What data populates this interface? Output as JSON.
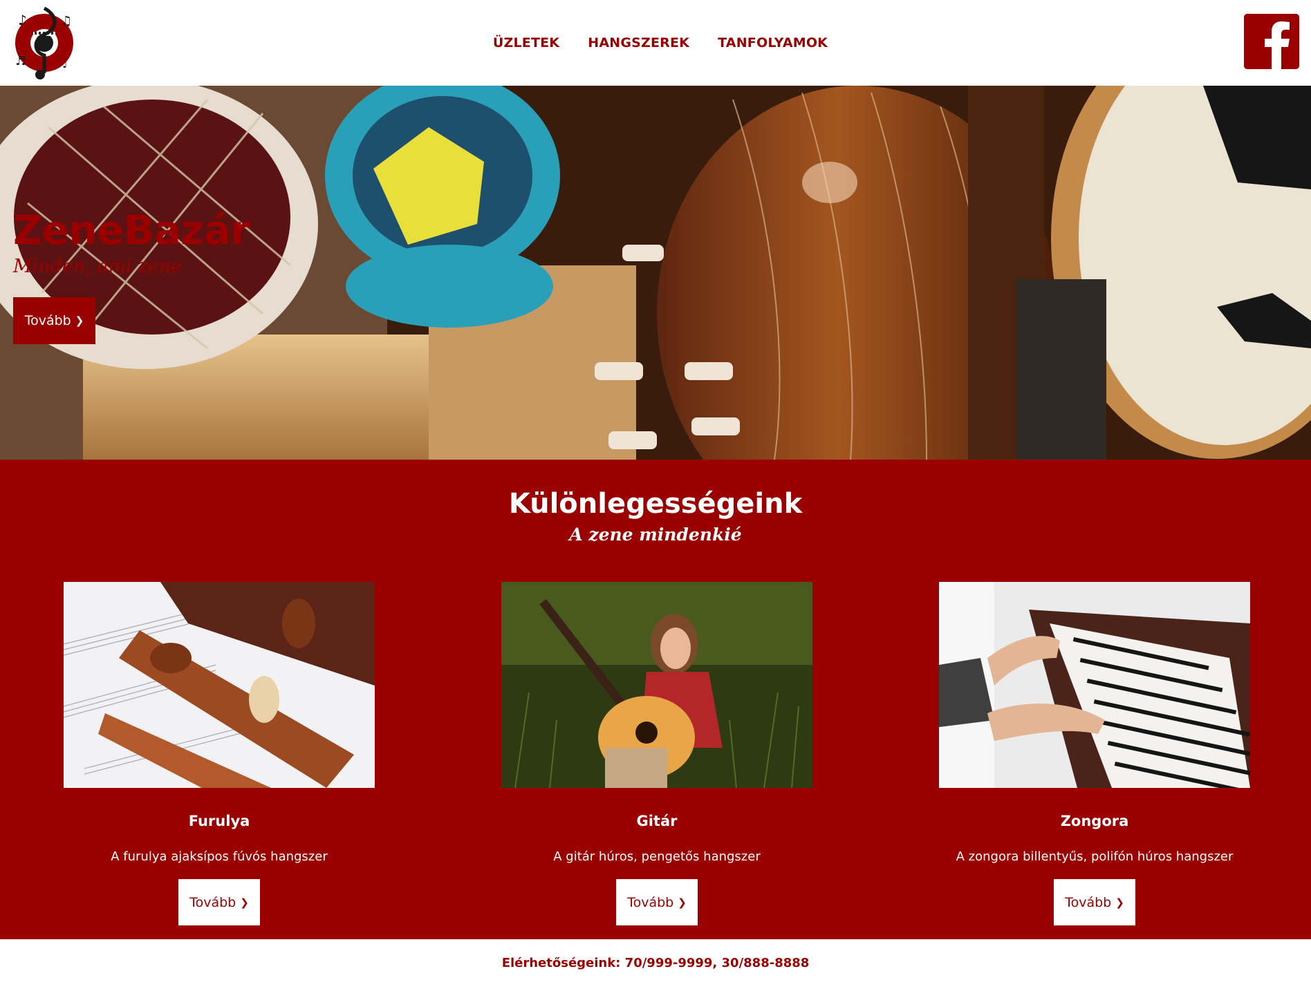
{
  "header": {
    "logo_icon": "music-note-logo-icon",
    "nav": [
      {
        "label": "ÜZLETEK"
      },
      {
        "label": "HANGSZEREK"
      },
      {
        "label": "TANFOLYAMOK"
      }
    ],
    "social_icon": "facebook-icon"
  },
  "hero": {
    "title": "ZeneBazár",
    "subtitle": "Minden, ami zene",
    "button_label": "Tovább",
    "button_icon": "chevron-right-icon"
  },
  "specials": {
    "title": "Különlegességeink",
    "subtitle": "A zene mindenkié",
    "cards": [
      {
        "title": "Furulya",
        "text": "A furulya ajaksípos fúvós hangszer",
        "button_label": "Tovább"
      },
      {
        "title": "Gitár",
        "text": "A gitár húros, pengetős hangszer",
        "button_label": "Tovább"
      },
      {
        "title": "Zongora",
        "text": "A zongora billentyűs, polifón húros hangszer",
        "button_label": "Tovább"
      }
    ]
  },
  "footer": {
    "contact": "Elérhetőségeink: 70/999-9999, 30/888-8888"
  },
  "colors": {
    "brand": "#9a0000",
    "background": "#ffffff"
  }
}
